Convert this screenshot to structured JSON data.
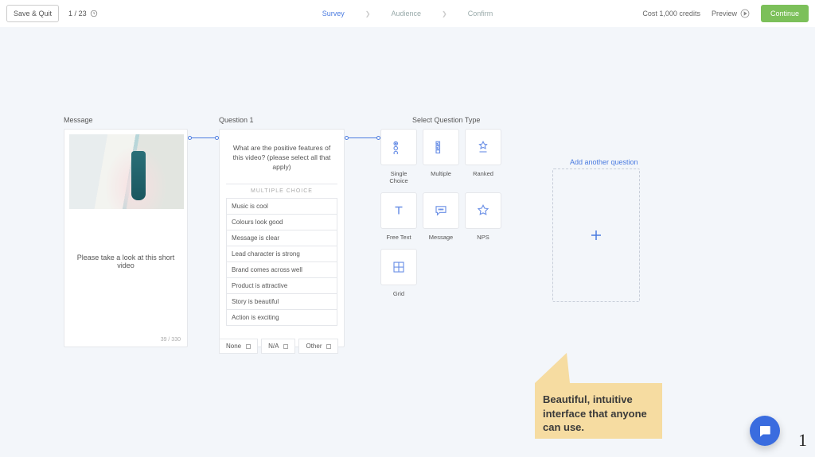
{
  "header": {
    "save_label": "Save & Quit",
    "counter_current": "1",
    "counter_total": "23",
    "steps": [
      "Survey",
      "Audience",
      "Confirm"
    ],
    "cost": "Cost 1,000 credits",
    "preview_label": "Preview",
    "continue_label": "Continue"
  },
  "message_card": {
    "title": "Message",
    "body": "Please take a look at this short video",
    "char_counter": "39 / 330"
  },
  "question_card": {
    "title": "Question 1",
    "prompt": "What are the positive features of this video? (please select all that apply)",
    "type_label": "MULTIPLE CHOICE",
    "options": [
      "Music is cool",
      "Colours look good",
      "Message is clear",
      "Lead character is strong",
      "Brand comes across well",
      "Product is attractive",
      "Story is beautiful",
      "Action is exciting"
    ],
    "footer_options": [
      "None",
      "N/A",
      "Other"
    ]
  },
  "types_panel": {
    "title": "Select Question Type",
    "types": [
      {
        "id": "single-choice",
        "label": "Single Choice"
      },
      {
        "id": "multiple",
        "label": "Multiple"
      },
      {
        "id": "ranked",
        "label": "Ranked"
      },
      {
        "id": "free-text",
        "label": "Free Text"
      },
      {
        "id": "message",
        "label": "Message"
      },
      {
        "id": "nps",
        "label": "NPS"
      },
      {
        "id": "grid",
        "label": "Grid"
      }
    ]
  },
  "add": {
    "label": "Add another question"
  },
  "callout": "Beautiful, intuitive interface that anyone can use.",
  "page_number": "1"
}
